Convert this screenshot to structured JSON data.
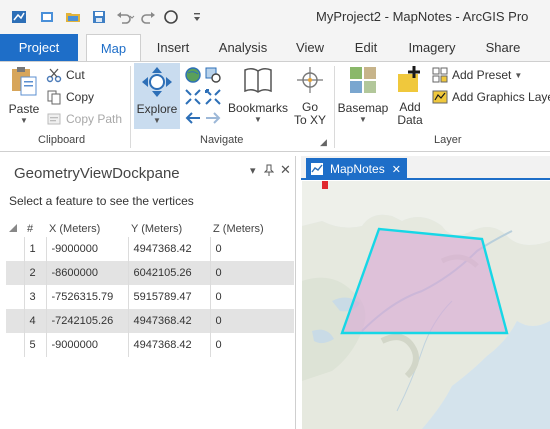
{
  "app": {
    "title": "MyProject2 - MapNotes - ArcGIS Pro"
  },
  "ribbon_tabs": [
    {
      "label": "Project",
      "active": false
    },
    {
      "label": "Map",
      "active": true
    },
    {
      "label": "Insert",
      "active": false
    },
    {
      "label": "Analysis",
      "active": false
    },
    {
      "label": "View",
      "active": false
    },
    {
      "label": "Edit",
      "active": false
    },
    {
      "label": "Imagery",
      "active": false
    },
    {
      "label": "Share",
      "active": false
    }
  ],
  "clipboard": {
    "group_label": "Clipboard",
    "paste": "Paste",
    "cut": "Cut",
    "copy": "Copy",
    "copy_path": "Copy Path"
  },
  "navigate": {
    "group_label": "Navigate",
    "explore": "Explore",
    "bookmarks": "Bookmarks",
    "go_to": "Go",
    "go_to_2": "To XY"
  },
  "layer": {
    "group_label": "Layer",
    "basemap": "Basemap",
    "add_data": "Add",
    "add_data_2": "Data",
    "add_preset": "Add Preset",
    "add_graphics_layer": "Add Graphics Layer"
  },
  "dockpane": {
    "title": "GeometryViewDockpane",
    "message": "Select a feature to see the vertices",
    "columns": [
      "#",
      "X (Meters)",
      "Y (Meters)",
      "Z (Meters)"
    ],
    "rows": [
      {
        "n": "1",
        "x": "-9000000",
        "y": "4947368.42",
        "z": "0"
      },
      {
        "n": "2",
        "x": "-8600000",
        "y": "6042105.26",
        "z": "0"
      },
      {
        "n": "3",
        "x": "-7526315.79",
        "y": "5915789.47",
        "z": "0"
      },
      {
        "n": "4",
        "x": "-7242105.26",
        "y": "4947368.42",
        "z": "0"
      },
      {
        "n": "5",
        "x": "-9000000",
        "y": "4947368.42",
        "z": "0"
      }
    ]
  },
  "map": {
    "tab_label": "MapNotes",
    "polygon_stroke": "#16d7e6",
    "polygon_fill": "#d9a6d6"
  },
  "colors": {
    "accent": "#1e6ec8"
  }
}
